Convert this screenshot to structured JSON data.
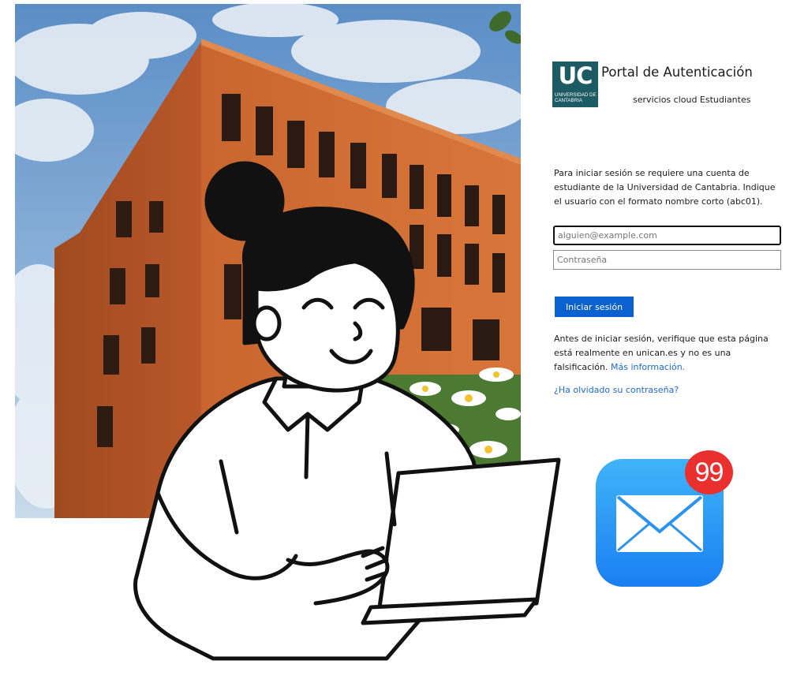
{
  "login": {
    "logo": {
      "letters": "UC",
      "subtext": "UNIVERSIDAD DE CANTABRIA"
    },
    "title": "Portal de Autenticación",
    "subtitle": "servicios cloud Estudiantes",
    "intro": "Para iniciar sesión se requiere una cuenta de estudiante de la Universidad de Cantabria. Indique el usuario con el formato nombre corto (abc01).",
    "email_placeholder": "alguien@example.com",
    "email_value": "",
    "password_placeholder": "Contraseña",
    "password_value": "",
    "signin_label": "Iniciar sesión",
    "warning_text": "Antes de iniciar sesión, verifique que esta página está realmente en unican.es y no es una falsificación.",
    "more_info_link": "Más información.",
    "forgot_link": "¿Ha olvidado su contraseña?"
  },
  "mail_app": {
    "icon": "mail-envelope-icon",
    "badge_count": "99",
    "colors": {
      "tile_top": "#3fb4f8",
      "tile_bottom": "#1a7ff2",
      "badge": "#ea2f2f"
    }
  },
  "colors": {
    "uc_brand": "#1c5b63",
    "button": "#0b61cf",
    "link": "#1c6ad6"
  }
}
